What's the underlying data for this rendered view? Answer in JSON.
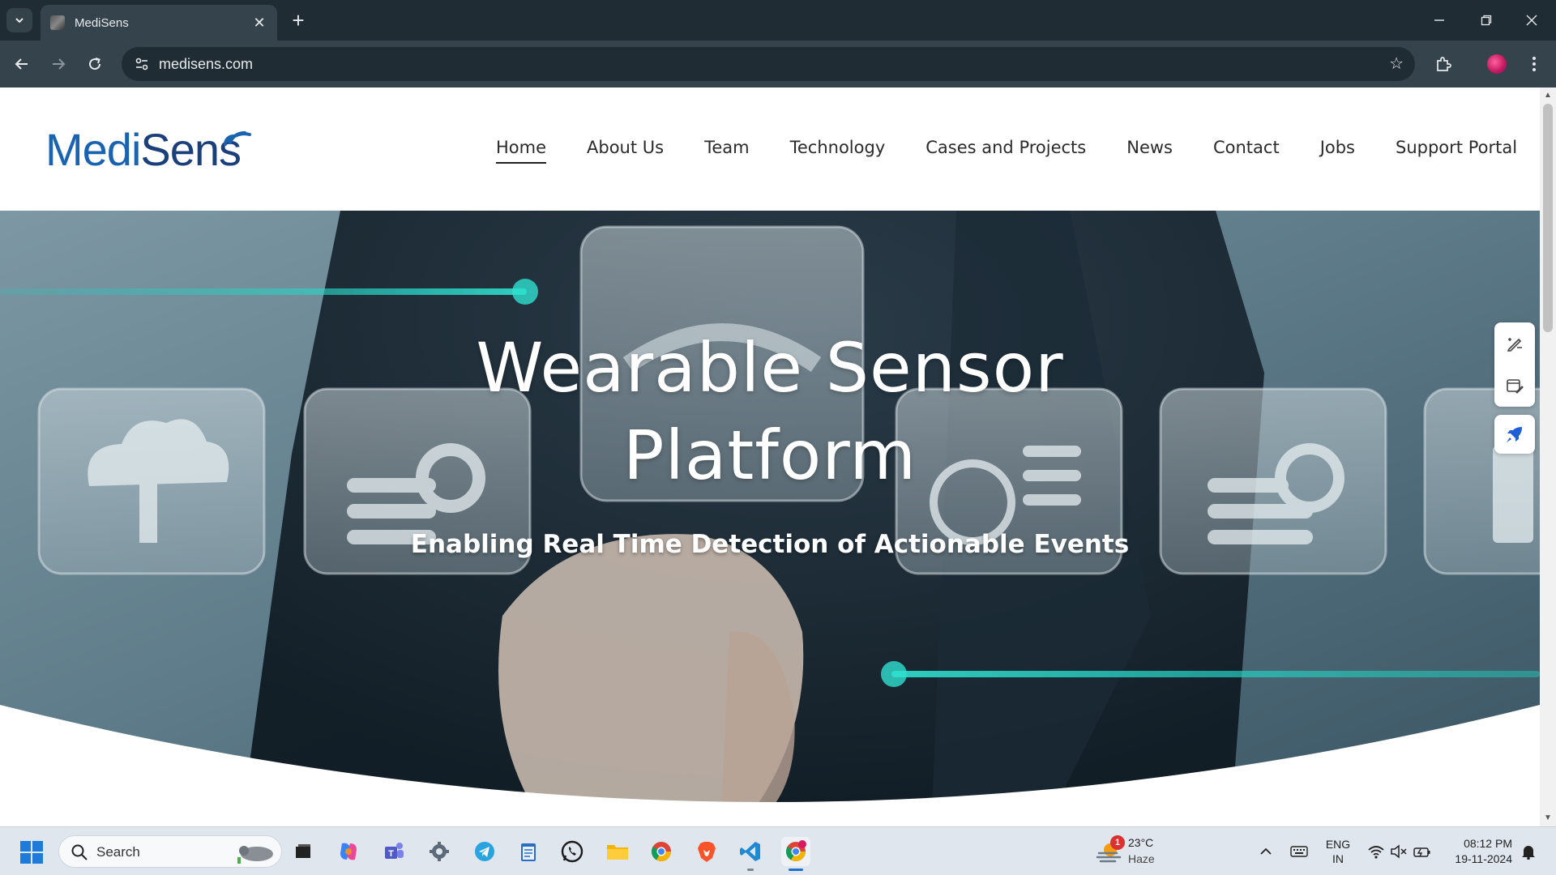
{
  "browser": {
    "tab_title": "MediSens",
    "url": "medisens.com"
  },
  "site": {
    "logo_text_a": "Medi",
    "logo_text_b": "Sens",
    "nav": [
      {
        "label": "Home",
        "active": true
      },
      {
        "label": "About Us"
      },
      {
        "label": "Team"
      },
      {
        "label": "Technology"
      },
      {
        "label": "Cases and Projects"
      },
      {
        "label": "News"
      },
      {
        "label": "Contact"
      },
      {
        "label": "Jobs"
      },
      {
        "label": "Support Portal"
      }
    ],
    "hero": {
      "title_line1": "Wearable Sensor",
      "title_line2": "Platform",
      "subtitle": "Enabling Real Time Detection of Actionable Events"
    }
  },
  "taskbar": {
    "search_label": "Search",
    "weather_temp": "23°C",
    "weather_cond": "Haze",
    "weather_badge": "1",
    "lang_line1": "ENG",
    "lang_line2": "IN",
    "time": "08:12 PM",
    "date": "19-11-2024"
  },
  "colors": {
    "brand_blue": "#1a63b0",
    "brand_navy": "#1a3f7a",
    "teal_glow": "#20c6b8",
    "chrome_dark": "#1f2c33",
    "taskbar": "#dfe6ee"
  }
}
